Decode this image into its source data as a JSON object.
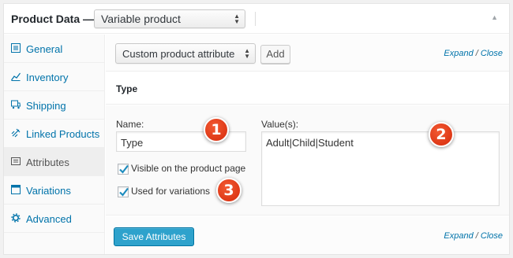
{
  "header": {
    "title": "Product Data —",
    "product_type": "Variable product",
    "toggle_glyph": "▲"
  },
  "sidebar": {
    "items": [
      {
        "label": "General",
        "icon": "general-icon"
      },
      {
        "label": "Inventory",
        "icon": "inventory-icon"
      },
      {
        "label": "Shipping",
        "icon": "shipping-icon"
      },
      {
        "label": "Linked Products",
        "icon": "link-icon"
      },
      {
        "label": "Attributes",
        "icon": "attributes-icon",
        "active": true
      },
      {
        "label": "Variations",
        "icon": "variations-icon"
      },
      {
        "label": "Advanced",
        "icon": "gear-icon"
      }
    ]
  },
  "toolbar": {
    "attribute_select": "Custom product attribute",
    "add_label": "Add",
    "expand": "Expand",
    "slash": " / ",
    "close": "Close"
  },
  "attribute": {
    "heading": "Type",
    "name_label": "Name:",
    "name_value": "Type",
    "values_label": "Value(s):",
    "values_value": "Adult|Child|Student",
    "visible_label": "Visible on the product page",
    "visible_checked": true,
    "variations_label": "Used for variations",
    "variations_checked": true
  },
  "footer": {
    "save_label": "Save Attributes",
    "expand": "Expand",
    "slash": " / ",
    "close": "Close"
  },
  "callouts": [
    "1",
    "2",
    "3"
  ],
  "colors": {
    "link": "#0073aa",
    "primary_button": "#2ea2cc",
    "callout": "#e03b17"
  }
}
